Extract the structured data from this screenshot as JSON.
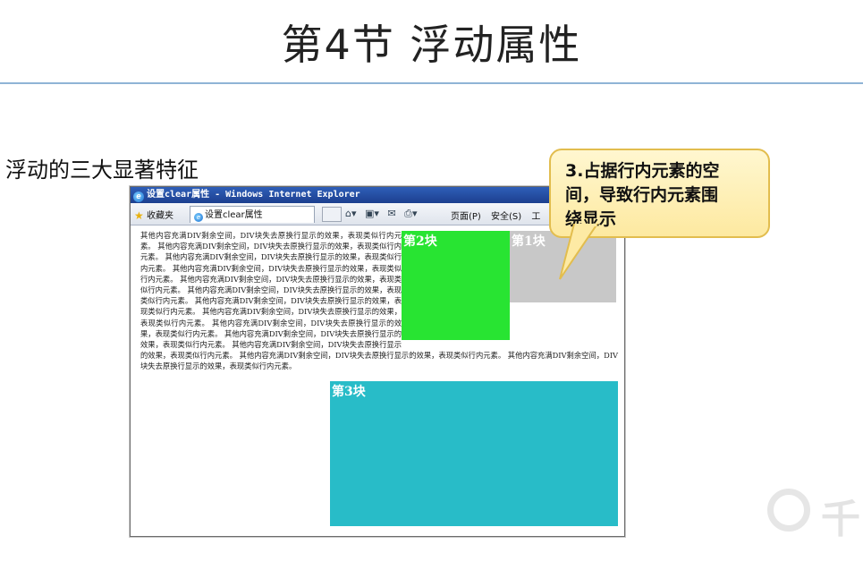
{
  "slide": {
    "title": "第4节 浮动属性",
    "subtitle": "浮动的三大显著特征"
  },
  "callout": {
    "line1": "3.占据行内元素的空",
    "line2": "间，导致行内元素围",
    "line3": "绕显示"
  },
  "browser": {
    "window_title": "设置clear属性 - Windows Internet Explorer",
    "favorites_label": "收藏夹",
    "tab_label": "设置clear属性",
    "menu_items": [
      "页面(P)",
      "安全(S)",
      "工"
    ],
    "icons": [
      "home-icon",
      "feeds-icon",
      "mail-icon",
      "print-icon"
    ]
  },
  "content": {
    "paragraph": "其他内容充满DIV剩余空间，DIV块失去原换行显示的效果，表现类似行内元素。 其他内容充满DIV剩余空间，DIV块失去原换行显示的效果，表现类似行内元素。 其他内容充满DIV剩余空间，DIV块失去原换行显示的效果，表现类似行内元素。 其他内容充满DIV剩余空间，DIV块失去原换行显示的效果，表现类似行内元素。 其他内容充满DIV剩余空间，DIV块失去原换行显示的效果，表现类似行内元素。 其他内容充满DIV剩余空间，DIV块失去原换行显示的效果，表现类似行内元素。 其他内容充满DIV剩余空间，DIV块失去原换行显示的效果，表现类似行内元素。 其他内容充满DIV剩余空间，DIV块失去原换行显示的效果，表现类似行内元素。 其他内容充满DIV剩余空间，DIV块失去原换行显示的效果，表现类似行内元素。 其他内容充满DIV剩余空间，DIV块失去原换行显示的效果，表现类似行内元素。 其他内容充满DIV剩余空间，DIV块失去原换行显示的效果，表现类似行内元素。 其他内容充满DIV剩余空间，DIV块失去原换行显示的效果，表现类似行内元素。 其他内容充满DIV剩余空间，DIV块失去原换行显示的效果，表现类似行内元素。",
    "block1_label": "第1块",
    "block2_label": "第2块",
    "block3_label": "第3块",
    "colors": {
      "block1": "#c8c8c8",
      "block2": "#28e432",
      "block3": "#28bcc8"
    }
  },
  "watermark": {
    "text": "千"
  }
}
